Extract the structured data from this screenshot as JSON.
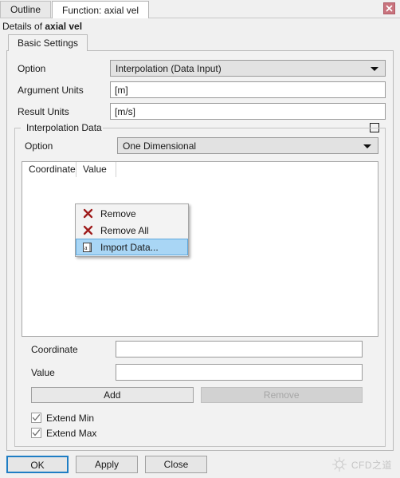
{
  "window": {
    "tabs": [
      {
        "label": "Outline",
        "active": false
      },
      {
        "label": "Function: axial vel",
        "active": true
      }
    ],
    "close_icon": "close-icon"
  },
  "details": {
    "prefix": "Details of ",
    "name": "axial vel"
  },
  "inner_tabs": [
    {
      "label": "Basic Settings"
    }
  ],
  "basic_settings": {
    "option": {
      "label": "Option",
      "value": "Interpolation (Data Input)"
    },
    "argument_units": {
      "label": "Argument Units",
      "value": "[m]"
    },
    "result_units": {
      "label": "Result Units",
      "value": "[m/s]"
    }
  },
  "interpolation_data": {
    "title": "Interpolation Data",
    "collapse_icon": "minus-box-icon",
    "option": {
      "label": "Option",
      "value": "One Dimensional"
    },
    "table": {
      "columns": [
        "Coordinate",
        "Value"
      ],
      "rows": []
    },
    "context_menu": {
      "items": [
        {
          "label": "Remove",
          "icon": "red-x-icon",
          "selected": false
        },
        {
          "label": "Remove All",
          "icon": "red-x-icon",
          "selected": false
        },
        {
          "label": "Import Data...",
          "icon": "text-file-icon",
          "selected": true
        }
      ]
    },
    "coordinate_field": {
      "label": "Coordinate",
      "value": "",
      "placeholder": ""
    },
    "value_field": {
      "label": "Value",
      "value": "",
      "placeholder": ""
    },
    "add_button": "Add",
    "remove_button": "Remove",
    "extend_min": {
      "label": "Extend Min",
      "checked": true
    },
    "extend_max": {
      "label": "Extend Max",
      "checked": true
    }
  },
  "footer": {
    "ok": "OK",
    "apply": "Apply",
    "close": "Close",
    "watermark": "CFD之道"
  },
  "colors": {
    "accent_blue": "#1f7ec4",
    "selection_blue": "#a9d6f5",
    "close_red": "#c9737d",
    "icon_red": "#9e1b1b",
    "panel_bg": "#f2f2f2",
    "window_bg": "#f0f0f0"
  }
}
